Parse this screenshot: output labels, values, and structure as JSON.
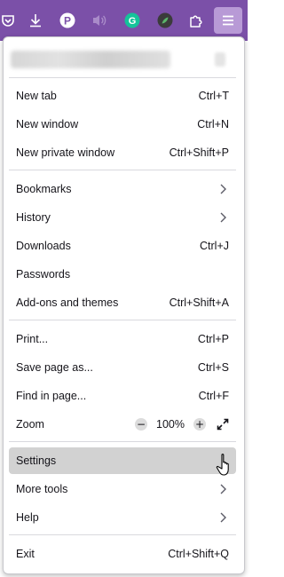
{
  "toolbar": {
    "bg": "#7b50a8",
    "icons": [
      "pocket-icon",
      "downloads-icon",
      "pinterest-extension-icon",
      "mute-icon",
      "grammarly-extension-icon",
      "extension-leaf-icon",
      "extensions-puzzle-icon",
      "hamburger-menu-icon"
    ]
  },
  "menu": {
    "groups": [
      [
        {
          "id": "new-tab",
          "label": "New tab",
          "shortcut": "Ctrl+T"
        },
        {
          "id": "new-window",
          "label": "New window",
          "shortcut": "Ctrl+N"
        },
        {
          "id": "new-private-window",
          "label": "New private window",
          "shortcut": "Ctrl+Shift+P"
        }
      ],
      [
        {
          "id": "bookmarks",
          "label": "Bookmarks",
          "submenu": true
        },
        {
          "id": "history",
          "label": "History",
          "submenu": true
        },
        {
          "id": "downloads",
          "label": "Downloads",
          "shortcut": "Ctrl+J"
        },
        {
          "id": "passwords",
          "label": "Passwords"
        },
        {
          "id": "add-ons-and-themes",
          "label": "Add-ons and themes",
          "shortcut": "Ctrl+Shift+A"
        }
      ],
      [
        {
          "id": "print",
          "label": "Print...",
          "shortcut": "Ctrl+P"
        },
        {
          "id": "save-page-as",
          "label": "Save page as...",
          "shortcut": "Ctrl+S"
        },
        {
          "id": "find-in-page",
          "label": "Find in page...",
          "shortcut": "Ctrl+F"
        }
      ]
    ],
    "zoom": {
      "label": "Zoom",
      "minus": "−",
      "value": "100%",
      "plus": "+"
    },
    "settings": {
      "label": "Settings",
      "hovered": true
    },
    "more_tools": {
      "label": "More tools"
    },
    "help": {
      "label": "Help"
    },
    "exit": {
      "label": "Exit",
      "shortcut": "Ctrl+Shift+Q"
    }
  }
}
